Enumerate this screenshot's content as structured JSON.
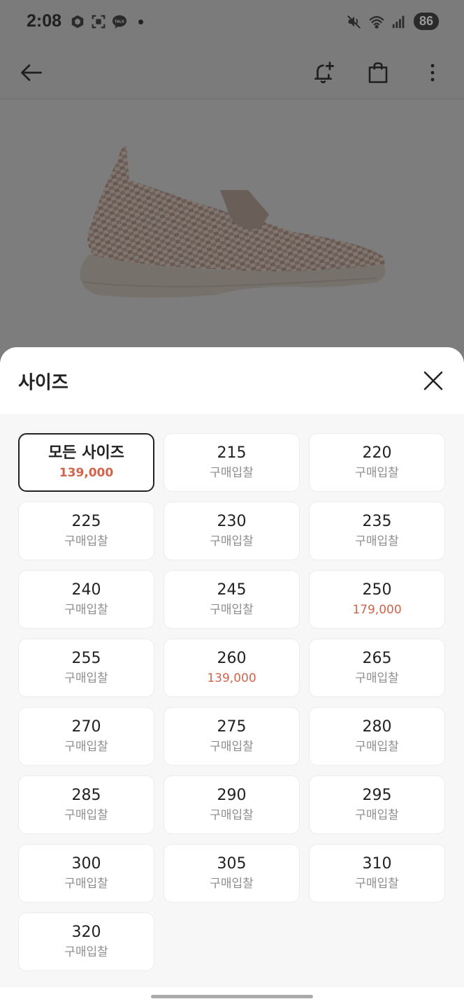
{
  "status_bar": {
    "time": "2:08",
    "battery": "86",
    "icons": [
      "box-icon",
      "screenshot-icon",
      "talk-icon",
      "mute-icon",
      "wifi-icon",
      "signal-icon"
    ]
  },
  "app_bar": {
    "icons": [
      "back-arrow-icon",
      "bell-plus-icon",
      "shopping-bag-icon",
      "more-vertical-icon"
    ]
  },
  "sheet": {
    "title": "사이즈",
    "close_icon": "close-icon"
  },
  "colors": {
    "price": "#d0654d",
    "muted": "#8e8e8e",
    "selected_border": "#222222"
  },
  "sizes": [
    {
      "label": "모든 사이즈",
      "sub": "139,000",
      "is_price": true,
      "selected": true
    },
    {
      "label": "215",
      "sub": "구매입찰",
      "is_price": false,
      "selected": false
    },
    {
      "label": "220",
      "sub": "구매입찰",
      "is_price": false,
      "selected": false
    },
    {
      "label": "225",
      "sub": "구매입찰",
      "is_price": false,
      "selected": false
    },
    {
      "label": "230",
      "sub": "구매입찰",
      "is_price": false,
      "selected": false
    },
    {
      "label": "235",
      "sub": "구매입찰",
      "is_price": false,
      "selected": false
    },
    {
      "label": "240",
      "sub": "구매입찰",
      "is_price": false,
      "selected": false
    },
    {
      "label": "245",
      "sub": "구매입찰",
      "is_price": false,
      "selected": false
    },
    {
      "label": "250",
      "sub": "179,000",
      "is_price": true,
      "selected": false
    },
    {
      "label": "255",
      "sub": "구매입찰",
      "is_price": false,
      "selected": false
    },
    {
      "label": "260",
      "sub": "139,000",
      "is_price": true,
      "selected": false
    },
    {
      "label": "265",
      "sub": "구매입찰",
      "is_price": false,
      "selected": false
    },
    {
      "label": "270",
      "sub": "구매입찰",
      "is_price": false,
      "selected": false
    },
    {
      "label": "275",
      "sub": "구매입찰",
      "is_price": false,
      "selected": false
    },
    {
      "label": "280",
      "sub": "구매입찰",
      "is_price": false,
      "selected": false
    },
    {
      "label": "285",
      "sub": "구매입찰",
      "is_price": false,
      "selected": false
    },
    {
      "label": "290",
      "sub": "구매입찰",
      "is_price": false,
      "selected": false
    },
    {
      "label": "295",
      "sub": "구매입찰",
      "is_price": false,
      "selected": false
    },
    {
      "label": "300",
      "sub": "구매입찰",
      "is_price": false,
      "selected": false
    },
    {
      "label": "305",
      "sub": "구매입찰",
      "is_price": false,
      "selected": false
    },
    {
      "label": "310",
      "sub": "구매입찰",
      "is_price": false,
      "selected": false
    },
    {
      "label": "320",
      "sub": "구매입찰",
      "is_price": false,
      "selected": false
    }
  ]
}
